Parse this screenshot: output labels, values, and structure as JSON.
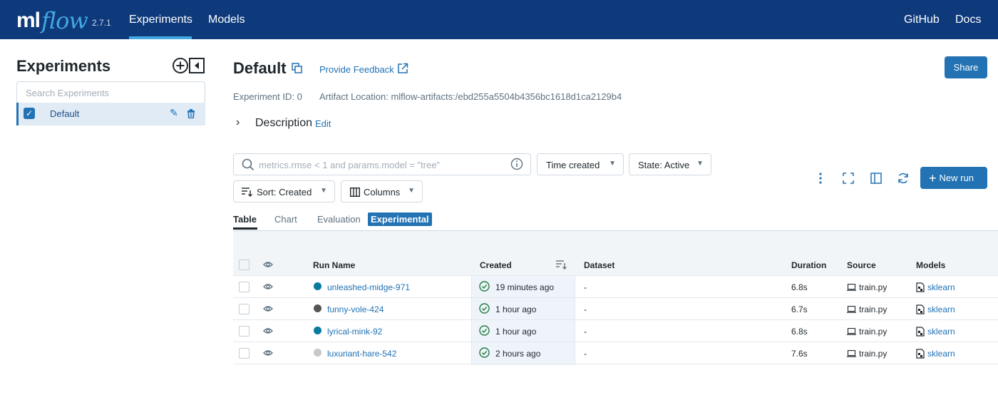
{
  "nav": {
    "logo_ml": "ml",
    "logo_flow": "flow",
    "version": "2.7.1",
    "links": [
      "Experiments",
      "Models"
    ],
    "right_links": [
      "GitHub",
      "Docs"
    ]
  },
  "sidebar": {
    "title": "Experiments",
    "search_placeholder": "Search Experiments",
    "experiments": [
      {
        "name": "Default",
        "checked": true
      }
    ]
  },
  "header": {
    "title": "Default",
    "feedback": "Provide Feedback",
    "share": "Share",
    "experiment_id": "Experiment ID: 0",
    "artifact_location": "Artifact Location: mlflow-artifacts:/ebd255a5504b4356bc1618d1ca2129b4",
    "description_label": "Description",
    "description_edit": "Edit"
  },
  "filters": {
    "search_placeholder": "metrics.rmse < 1 and params.model = \"tree\"",
    "time_created": "Time created",
    "state": "State: Active",
    "sort": "Sort: Created",
    "columns": "Columns",
    "new_run": "New run"
  },
  "tabs": {
    "table": "Table",
    "chart": "Chart",
    "evaluation": "Evaluation",
    "experimental": "Experimental"
  },
  "table": {
    "headers": {
      "run_name": "Run Name",
      "created": "Created",
      "dataset": "Dataset",
      "duration": "Duration",
      "source": "Source",
      "models": "Models"
    },
    "rows": [
      {
        "name": "unleashed-midge-971",
        "color": "#077a9d",
        "created": "19 minutes ago",
        "dataset": "-",
        "duration": "6.8s",
        "source": "train.py",
        "model": "sklearn"
      },
      {
        "name": "funny-vole-424",
        "color": "#555555",
        "created": "1 hour ago",
        "dataset": "-",
        "duration": "6.7s",
        "source": "train.py",
        "model": "sklearn"
      },
      {
        "name": "lyrical-mink-92",
        "color": "#077a9d",
        "created": "1 hour ago",
        "dataset": "-",
        "duration": "6.8s",
        "source": "train.py",
        "model": "sklearn"
      },
      {
        "name": "luxuriant-hare-542",
        "color": "#c8c8c8",
        "created": "2 hours ago",
        "dataset": "-",
        "duration": "7.6s",
        "source": "train.py",
        "model": "sklearn"
      }
    ]
  },
  "colors": {
    "nav_bg": "#0e3a7c",
    "accent": "#2272b4",
    "logo_flow": "#43a7e0",
    "success": "#277c43"
  }
}
